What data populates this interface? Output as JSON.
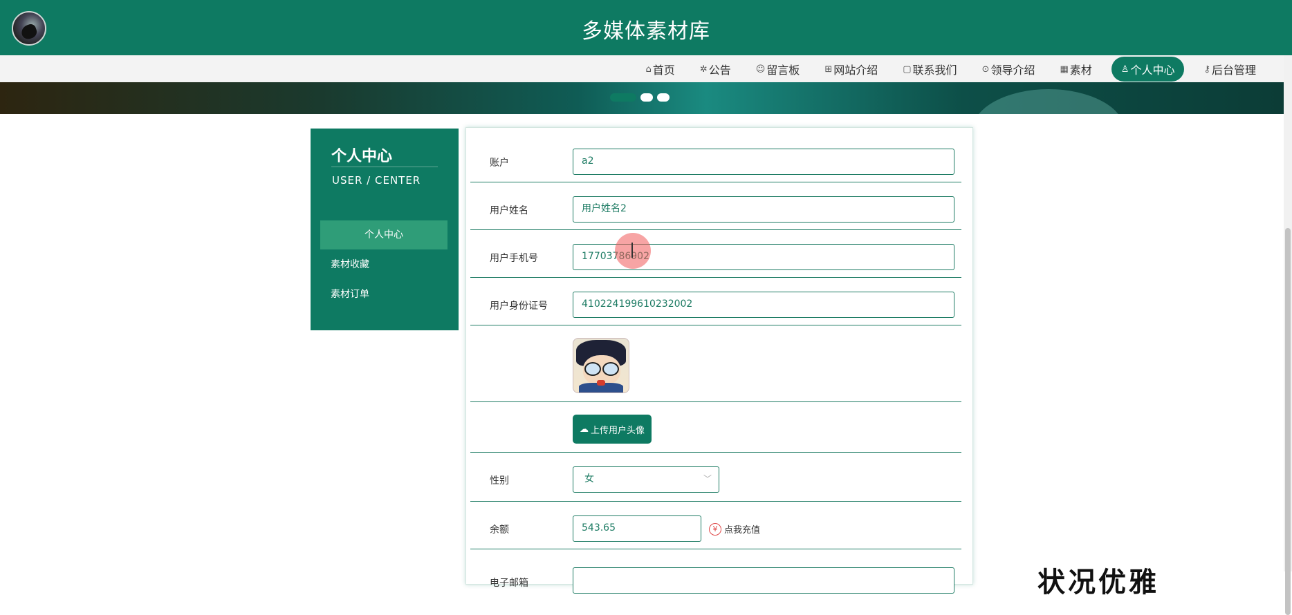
{
  "header": {
    "site_title": "多媒体素材库",
    "logo_icon": "crow-logo-icon",
    "accent_color": "#0e7a62"
  },
  "nav": {
    "items": [
      {
        "icon": "⌂",
        "label": "首页"
      },
      {
        "icon": "✲",
        "label": "公告"
      },
      {
        "icon": "☺",
        "label": "留言板"
      },
      {
        "icon": "⊞",
        "label": "网站介绍"
      },
      {
        "icon": "▢",
        "label": "联系我们"
      },
      {
        "icon": "⊙",
        "label": "领导介绍"
      },
      {
        "icon": "▦",
        "label": "素材"
      },
      {
        "icon": "♙",
        "label": "个人中心"
      },
      {
        "icon": "⚷",
        "label": "后台管理"
      }
    ],
    "active_label": "个人中心"
  },
  "sidebar": {
    "title": "个人中心",
    "subtitle": "USER / CENTER",
    "items": [
      {
        "label": "个人中心"
      },
      {
        "label": "素材收藏"
      },
      {
        "label": "素材订单"
      }
    ]
  },
  "form": {
    "account": {
      "label": "账户",
      "value": "a2"
    },
    "username": {
      "label": "用户姓名",
      "value": "用户姓名2"
    },
    "phone": {
      "label": "用户手机号",
      "value": "17703786902"
    },
    "id_number": {
      "label": "用户身份证号",
      "value": "410224199610232002"
    },
    "upload_button": "上传用户头像",
    "gender": {
      "label": "性别",
      "value": "女"
    },
    "balance": {
      "label": "余额",
      "value": "543.65",
      "recharge_label": "点我充值"
    },
    "email": {
      "label": "电子邮箱"
    }
  },
  "overlay": {
    "corner_text": "状况优雅"
  }
}
